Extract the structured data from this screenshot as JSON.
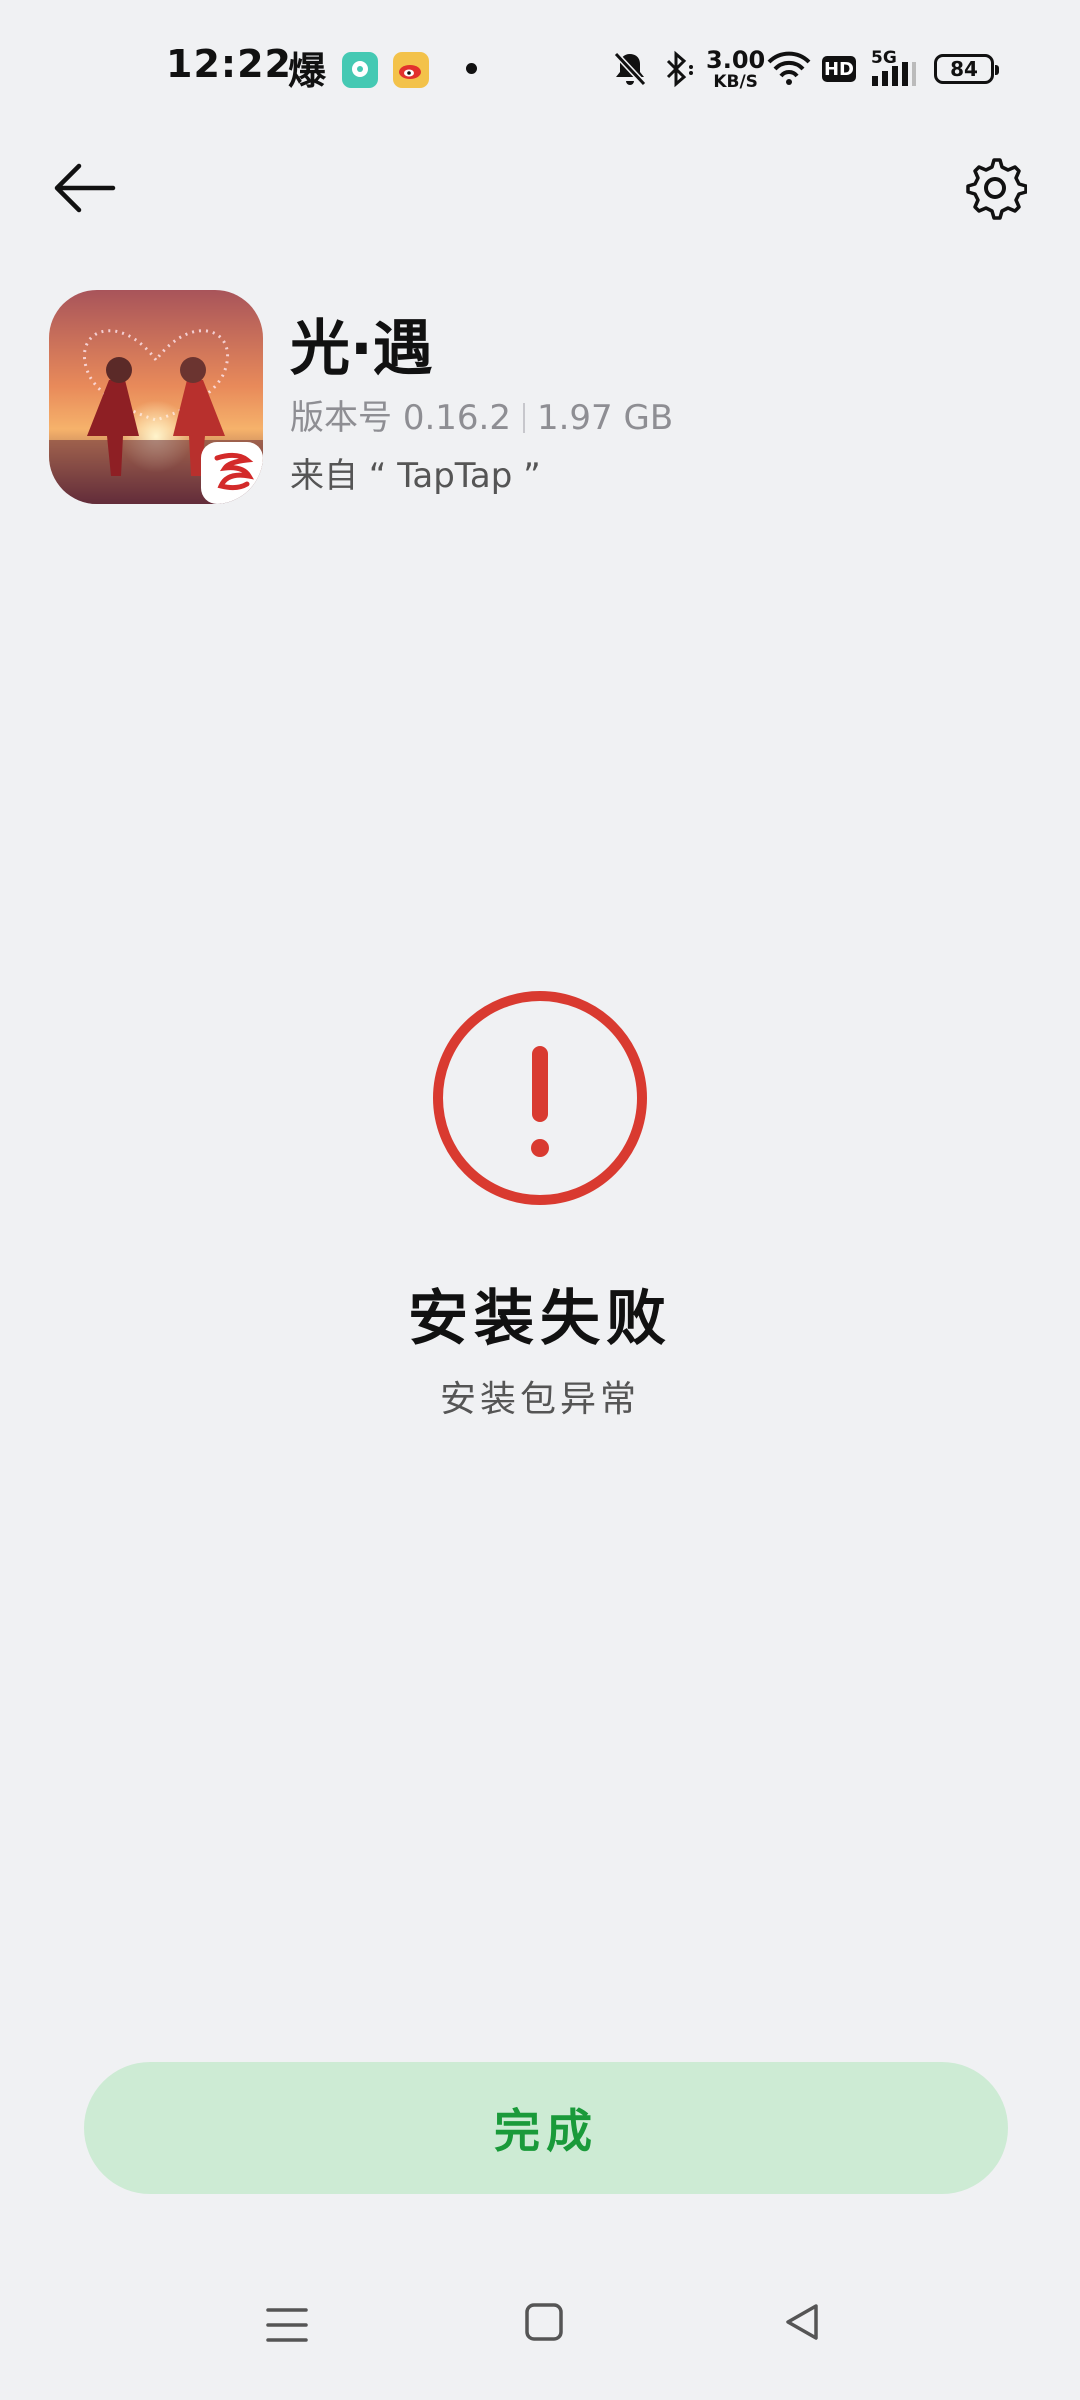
{
  "status_bar": {
    "time": "12:22",
    "notif_char": "爆",
    "net_speed_value": "3.00",
    "net_speed_unit": "KB/S",
    "hd_label": "HD",
    "network_label": "5G",
    "battery_level": "84",
    "icons": [
      "mute-bell-icon",
      "bluetooth-icon",
      "wifi-icon",
      "signal-icon"
    ]
  },
  "app": {
    "name": "光·遇",
    "version_label": "版本号",
    "version": "0.16.2",
    "size": "1.97 GB",
    "source": "来自 “ TapTap ”"
  },
  "result": {
    "title": "安装失败",
    "subtitle": "安装包异常",
    "status_color": "#d93a30"
  },
  "actions": {
    "done_label": "完成",
    "done_text_color": "#1a9a3a",
    "done_bg_color": "#cdebd4"
  }
}
